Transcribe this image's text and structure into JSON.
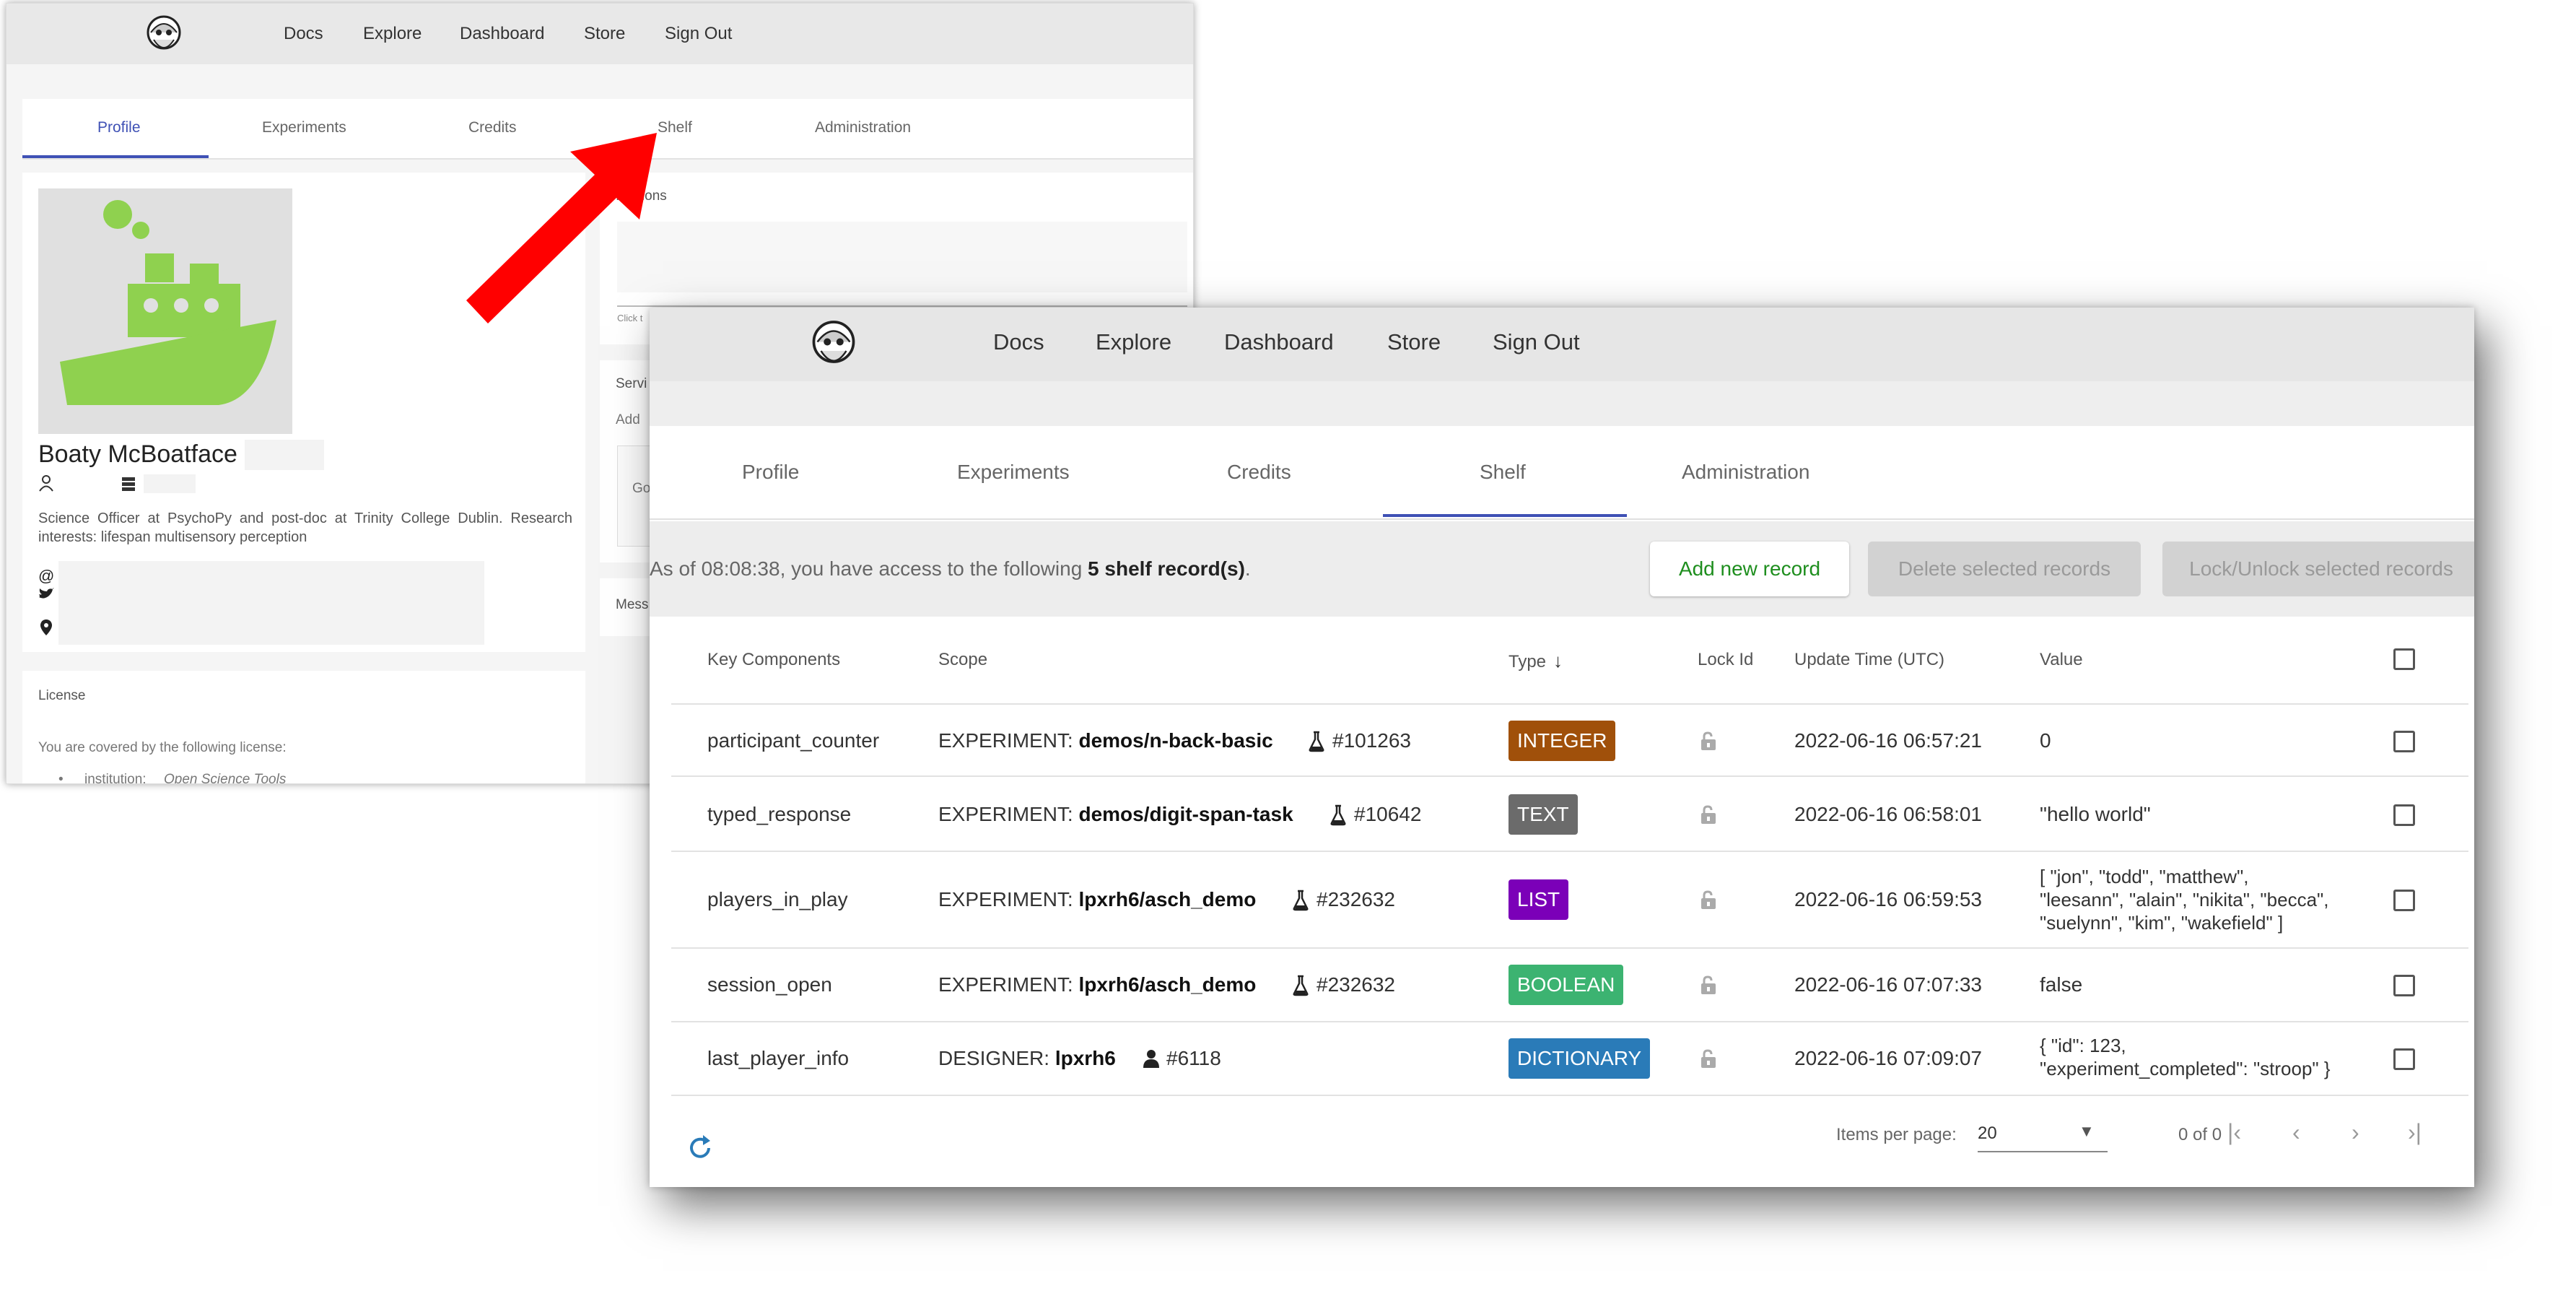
{
  "background_window": {
    "nav": [
      "Docs",
      "Explore",
      "Dashboard",
      "Store",
      "Sign Out"
    ],
    "tabs": [
      "Profile",
      "Experiments",
      "Credits",
      "Shelf",
      "Administration"
    ],
    "name": "Boaty McBoatface",
    "bio": "Science Officer at PsychoPy and post-doc at Trinity College Dublin. Research interests: lifespan multisensory perception",
    "right_card_title": "...iations",
    "click_hint": "Click t",
    "services_title": "Servi",
    "services_add": "Add",
    "services_go": "Go",
    "messages_title": "Mess",
    "license_title": "License",
    "license_text": "You are covered by the following license:",
    "license_item_label": "institution:",
    "license_item_value": "Open Science Tools"
  },
  "foreground_window": {
    "nav": [
      "Docs",
      "Explore",
      "Dashboard",
      "Store",
      "Sign Out"
    ],
    "tabs": [
      "Profile",
      "Experiments",
      "Credits",
      "Shelf",
      "Administration"
    ],
    "active_tab": "Shelf",
    "info": {
      "prefix": "As of 08:08:38, you have access to the following",
      "count": "5 shelf record(s)",
      "suffix": "."
    },
    "buttons": {
      "add": "Add new record",
      "delete": "Delete selected records",
      "lock": "Lock/Unlock selected records"
    },
    "columns": {
      "key": "Key Components",
      "scope": "Scope",
      "type": "Type",
      "lock": "Lock Id",
      "time": "Update Time (UTC)",
      "value": "Value"
    },
    "rows": [
      {
        "key": "participant_counter",
        "scope_kind": "EXPERIMENT:",
        "scope_name": "demos/n-back-basic",
        "scope_icon": "flask-icon",
        "scope_id": "#101263",
        "type": "INTEGER",
        "type_color": "#a0500a",
        "time": "2022-06-16 06:57:21",
        "value": "0"
      },
      {
        "key": "typed_response",
        "scope_kind": "EXPERIMENT:",
        "scope_name": "demos/digit-span-task",
        "scope_icon": "flask-icon",
        "scope_id": "#10642",
        "type": "TEXT",
        "type_color": "#6b6b6b",
        "time": "2022-06-16 06:58:01",
        "value": "\"hello world\""
      },
      {
        "key": "players_in_play",
        "scope_kind": "EXPERIMENT:",
        "scope_name": "lpxrh6/asch_demo",
        "scope_icon": "flask-icon",
        "scope_id": "#232632",
        "type": "LIST",
        "type_color": "#7b00b8",
        "time": "2022-06-16 06:59:53",
        "value_lines": [
          "[ \"jon\", \"todd\", \"matthew\",",
          "\"leesann\", \"alain\", \"nikita\", \"becca\",",
          "\"suelynn\", \"kim\", \"wakefield\" ]"
        ]
      },
      {
        "key": "session_open",
        "scope_kind": "EXPERIMENT:",
        "scope_name": "lpxrh6/asch_demo",
        "scope_icon": "flask-icon",
        "scope_id": "#232632",
        "type": "BOOLEAN",
        "type_color": "#3cb371",
        "time": "2022-06-16 07:07:33",
        "value": "false"
      },
      {
        "key": "last_player_info",
        "scope_kind": "DESIGNER:",
        "scope_name": "lpxrh6",
        "scope_icon": "person-icon",
        "scope_id": "#6118",
        "type": "DICTIONARY",
        "type_color": "#2a7bb8",
        "time": "2022-06-16 07:09:07",
        "value_lines": [
          "{ \"id\": 123,",
          "\"experiment_completed\": \"stroop\" }"
        ]
      }
    ],
    "pagination": {
      "items_per_page_label": "Items per page:",
      "items_per_page": "20",
      "range": "0 of 0"
    },
    "colors": {
      "accent": "#3f51b5",
      "add_button_text": "#1e8e1e",
      "arrow": "#ff0000",
      "logo_green": "#8fd14f"
    }
  }
}
